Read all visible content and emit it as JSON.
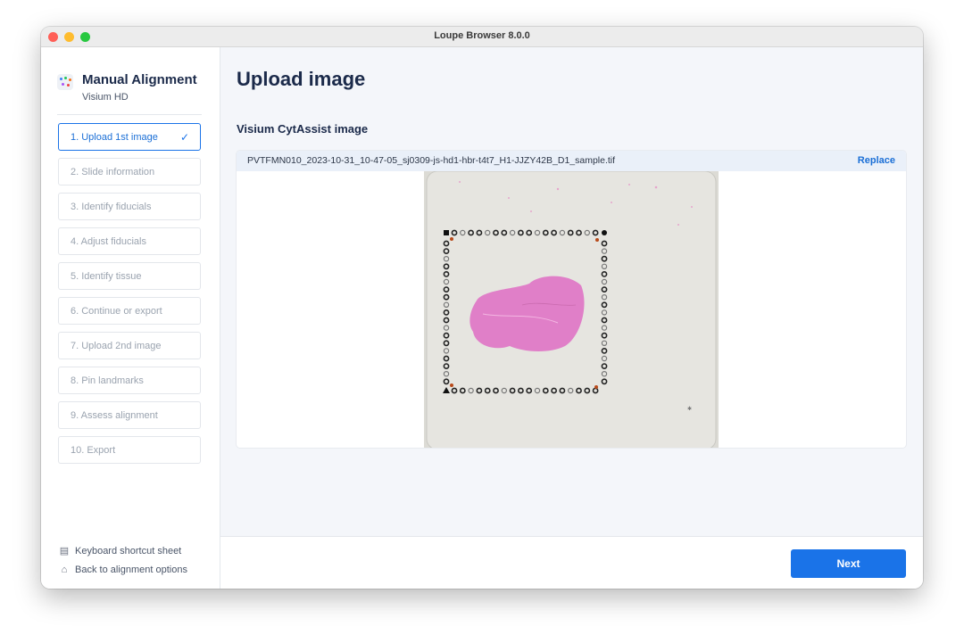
{
  "window": {
    "title": "Loupe Browser 8.0.0"
  },
  "sidebar": {
    "app_title": "Manual Alignment",
    "app_subtitle": "Visium HD",
    "steps": [
      {
        "label": "1. Upload 1st image",
        "state": "active"
      },
      {
        "label": "2. Slide information",
        "state": "disabled"
      },
      {
        "label": "3. Identify fiducials",
        "state": "disabled"
      },
      {
        "label": "4. Adjust fiducials",
        "state": "disabled"
      },
      {
        "label": "5. Identify tissue",
        "state": "disabled"
      },
      {
        "label": "6. Continue or export",
        "state": "disabled"
      },
      {
        "label": "7. Upload 2nd image",
        "state": "disabled"
      },
      {
        "label": "8. Pin landmarks",
        "state": "disabled"
      },
      {
        "label": "9. Assess alignment",
        "state": "disabled"
      },
      {
        "label": "10. Export",
        "state": "disabled"
      }
    ],
    "footer_links": [
      {
        "label": "Keyboard shortcut sheet",
        "icon": "keyboard-icon"
      },
      {
        "label": "Back to alignment options",
        "icon": "home-icon"
      }
    ]
  },
  "main": {
    "title": "Upload image",
    "section_title": "Visium CytAssist image",
    "file_name": "PVTFMN010_2023-10-31_10-47-05_sj0309-js-hd1-hbr-t4t7_H1-JJZY42B_D1_sample.tif",
    "replace_label": "Replace"
  },
  "footer": {
    "next_label": "Next"
  },
  "colors": {
    "accent": "#1a73e8",
    "tissue": "#e07fc8",
    "title": "#1b2a4a"
  }
}
